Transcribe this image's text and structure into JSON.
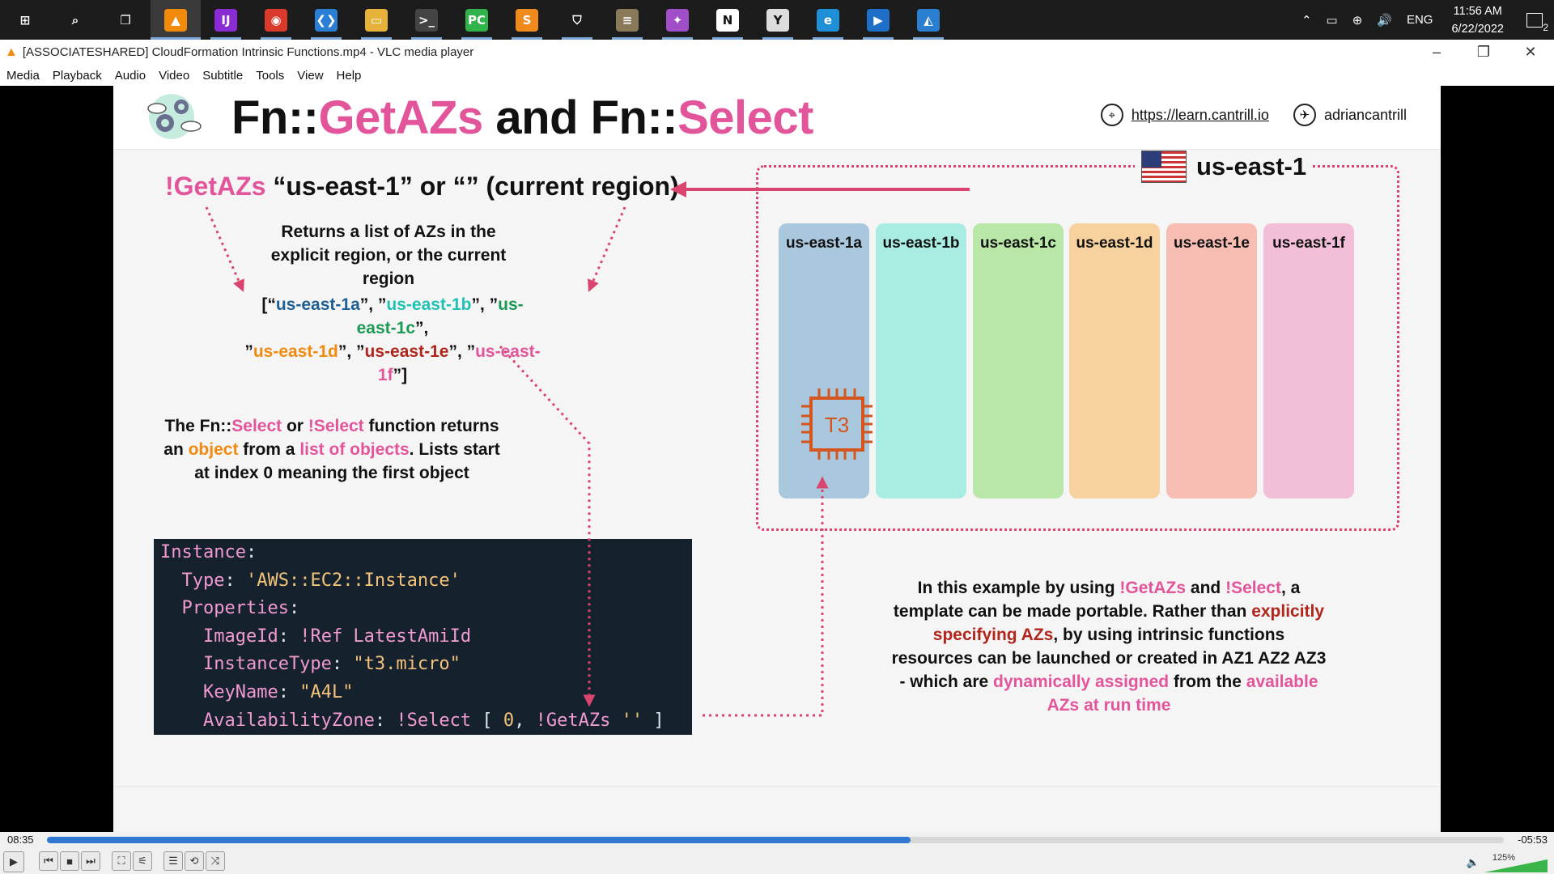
{
  "taskbar": {
    "apps": [
      {
        "name": "start-icon",
        "glyph": "⊞",
        "color": "#1c1c1c"
      },
      {
        "name": "search-icon",
        "glyph": "⌕",
        "color": "#1c1c1c"
      },
      {
        "name": "task-view-icon",
        "glyph": "❐",
        "color": "#1c1c1c"
      },
      {
        "name": "vlc-icon",
        "glyph": "▲",
        "color": "#f28a0c"
      },
      {
        "name": "intellij-icon",
        "glyph": "IJ",
        "color": "#8b2bd4"
      },
      {
        "name": "chrome-icon",
        "glyph": "◉",
        "color": "#d93a2b"
      },
      {
        "name": "vscode-icon",
        "glyph": "❮❯",
        "color": "#2a7fd4"
      },
      {
        "name": "file-explorer-icon",
        "glyph": "▭",
        "color": "#e7b23a"
      },
      {
        "name": "terminal-icon",
        "glyph": ">_",
        "color": "#444444"
      },
      {
        "name": "pycharm-icon",
        "glyph": "PC",
        "color": "#2fb34a"
      },
      {
        "name": "sublime-icon",
        "glyph": "S",
        "color": "#f08a1c"
      },
      {
        "name": "security-icon",
        "glyph": "⛉",
        "color": "#1c1c1c"
      },
      {
        "name": "stack-app-icon",
        "glyph": "≡",
        "color": "#8a7a5a"
      },
      {
        "name": "media-app-icon",
        "glyph": "✦",
        "color": "#a04fc9"
      },
      {
        "name": "notion-icon",
        "glyph": "N",
        "color": "#ffffff"
      },
      {
        "name": "clock-app-icon",
        "glyph": "Y",
        "color": "#dddddd"
      },
      {
        "name": "edge-icon",
        "glyph": "e",
        "color": "#1f8fd8"
      },
      {
        "name": "media-player-icon",
        "glyph": "▶",
        "color": "#1f6fc8"
      },
      {
        "name": "photos-icon",
        "glyph": "◭",
        "color": "#2b7fd0"
      }
    ],
    "tray": {
      "chevron": "⌃",
      "battery": "▭",
      "network": "⊕",
      "volume": "🔊",
      "language": "ENG",
      "time": "11:56 AM",
      "date": "6/22/2022",
      "notifications_count": "2"
    }
  },
  "window": {
    "title": "[ASSOCIATESHARED] CloudFormation Intrinsic Functions.mp4 - VLC media player",
    "menus": [
      "Media",
      "Playback",
      "Audio",
      "Video",
      "Subtitle",
      "Tools",
      "View",
      "Help"
    ]
  },
  "slide": {
    "title_a": "Fn::",
    "title_b": "GetAZs",
    "title_c": " and Fn::",
    "title_d": "Select",
    "link": "https://learn.cantrill.io",
    "handle": "adriancantrill",
    "getazs_a": "!GetAZs",
    "getazs_b": " “us-east-1” or “” (current region)",
    "returns": "Returns a list of AZs in the explicit region, or the current region",
    "list": {
      "open": "[“",
      "az1": "us-east-1a",
      "sep1": "”, ”",
      "az2": "us-east-1b",
      "sep2": "”, ”",
      "az3": "us-east-1c",
      "sep3": "”,",
      "q4": "”",
      "az4": "us-east-1d",
      "sep4": "”, ”",
      "az5": "us-east-1e",
      "sep5": "”, ”",
      "az6": "us-east-1f",
      "close": "”]"
    },
    "select_desc": {
      "p1": "The Fn::",
      "p2": "Select",
      "p3": " or ",
      "p4": "!Select",
      "p5": " function returns an ",
      "p6": "object",
      "p7": " from a ",
      "p8": "list of objects",
      "p9": ". Lists start at index 0 meaning the first object"
    },
    "code": {
      "l1k": "Instance",
      "l1c": ":",
      "l2k": "  Type",
      "l2c": ": ",
      "l2v": "'AWS::EC2::Instance'",
      "l3k": "  Properties",
      "l3c": ":",
      "l4k": "    ImageId",
      "l4c": ": ",
      "l4v": "!Ref LatestAmiId",
      "l5k": "    InstanceType",
      "l5c": ": ",
      "l5v": "\"t3.micro\"",
      "l6k": "    KeyName",
      "l6c": ": ",
      "l6v": "\"A4L\"",
      "l7k": "    AvailabilityZone",
      "l7c": ": ",
      "l7v1": "!Select",
      "l7w1": " [ ",
      "l7n": "0",
      "l7w2": ", ",
      "l7v2": "!GetAZs",
      "l7w3": " ",
      "l7v3": "''",
      "l7w4": " ]"
    },
    "region": "us-east-1",
    "azs": [
      {
        "label": "us-east-1a",
        "color": "#a9c7dd"
      },
      {
        "label": "us-east-1b",
        "color": "#a9ece1"
      },
      {
        "label": "us-east-1c",
        "color": "#b9e7a8"
      },
      {
        "label": "us-east-1d",
        "color": "#f7d29e"
      },
      {
        "label": "us-east-1e",
        "color": "#f7bdb2"
      },
      {
        "label": "us-east-1f",
        "color": "#f3bfd8"
      }
    ],
    "chip_label": "T3",
    "example": {
      "p1": "In this example by using ",
      "p2": "!GetAZs",
      "p3": " and ",
      "p4": "!Select",
      "p5": ", a template can be made portable. Rather than ",
      "p6": "explicitly specifying AZs",
      "p7": ", by using intrinsic functions resources can be launched or created in AZ1 AZ2 AZ3 - which are ",
      "p8": "dynamically assigned",
      "p9": " from the ",
      "p10": "available AZs at run time"
    }
  },
  "player": {
    "elapsed": "08:35",
    "remaining": "-05:53",
    "progress": 0.593,
    "volume_pct": "125%",
    "volume_level": 1.0,
    "buttons": [
      {
        "name": "play-icon",
        "glyph": "▶"
      },
      {
        "name": "previous-icon",
        "glyph": "⏮"
      },
      {
        "name": "stop-icon",
        "glyph": "■"
      },
      {
        "name": "next-icon",
        "glyph": "⏭"
      },
      {
        "name": "fullscreen-icon",
        "glyph": "⛶"
      },
      {
        "name": "extended-settings-icon",
        "glyph": "⚟"
      },
      {
        "name": "playlist-icon",
        "glyph": "☰"
      },
      {
        "name": "loop-icon",
        "glyph": "⟲"
      },
      {
        "name": "shuffle-icon",
        "glyph": "⤨"
      }
    ]
  }
}
